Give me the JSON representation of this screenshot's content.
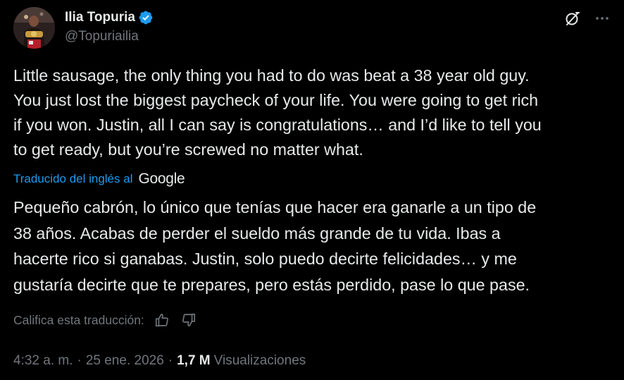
{
  "author": {
    "display_name": "Ilia Topuria",
    "handle": "@Topuriailia",
    "verified": true
  },
  "header_icons": [
    "grok-icon",
    "more-icon"
  ],
  "tweet": {
    "text": "Little sausage, the only thing you had to do was beat a 38 year old guy.\nYou just lost the biggest paycheck of your life. You were going to get rich\nif you won. Justin, all I can say is congratulations… and I’d like to tell you\nto get ready, but you’re screwed no matter what."
  },
  "translation": {
    "label": "Traducido del inglés al",
    "provider": "Google",
    "text": "Pequeño cabrón, lo único que tenías que hacer era ganarle a un tipo de\n38 años. Acabas de perder el sueldo más grande de tu vida. Ibas a\nhacerte rico si ganabas. Justin, solo puedo decirte felicidades… y me\ngustaría decirte que te prepares, pero estás perdido, pase lo que pase.",
    "rate_label": "Califica esta traducción:"
  },
  "meta": {
    "time": "4:32 a. m.",
    "separator": "·",
    "date": "25 ene. 2026",
    "views_count": "1,7 M",
    "views_label": "Visualizaciones"
  },
  "colors": {
    "background": "#000000",
    "text": "#e7e9ea",
    "secondary": "#71767b",
    "accent": "#1d9bf0"
  }
}
